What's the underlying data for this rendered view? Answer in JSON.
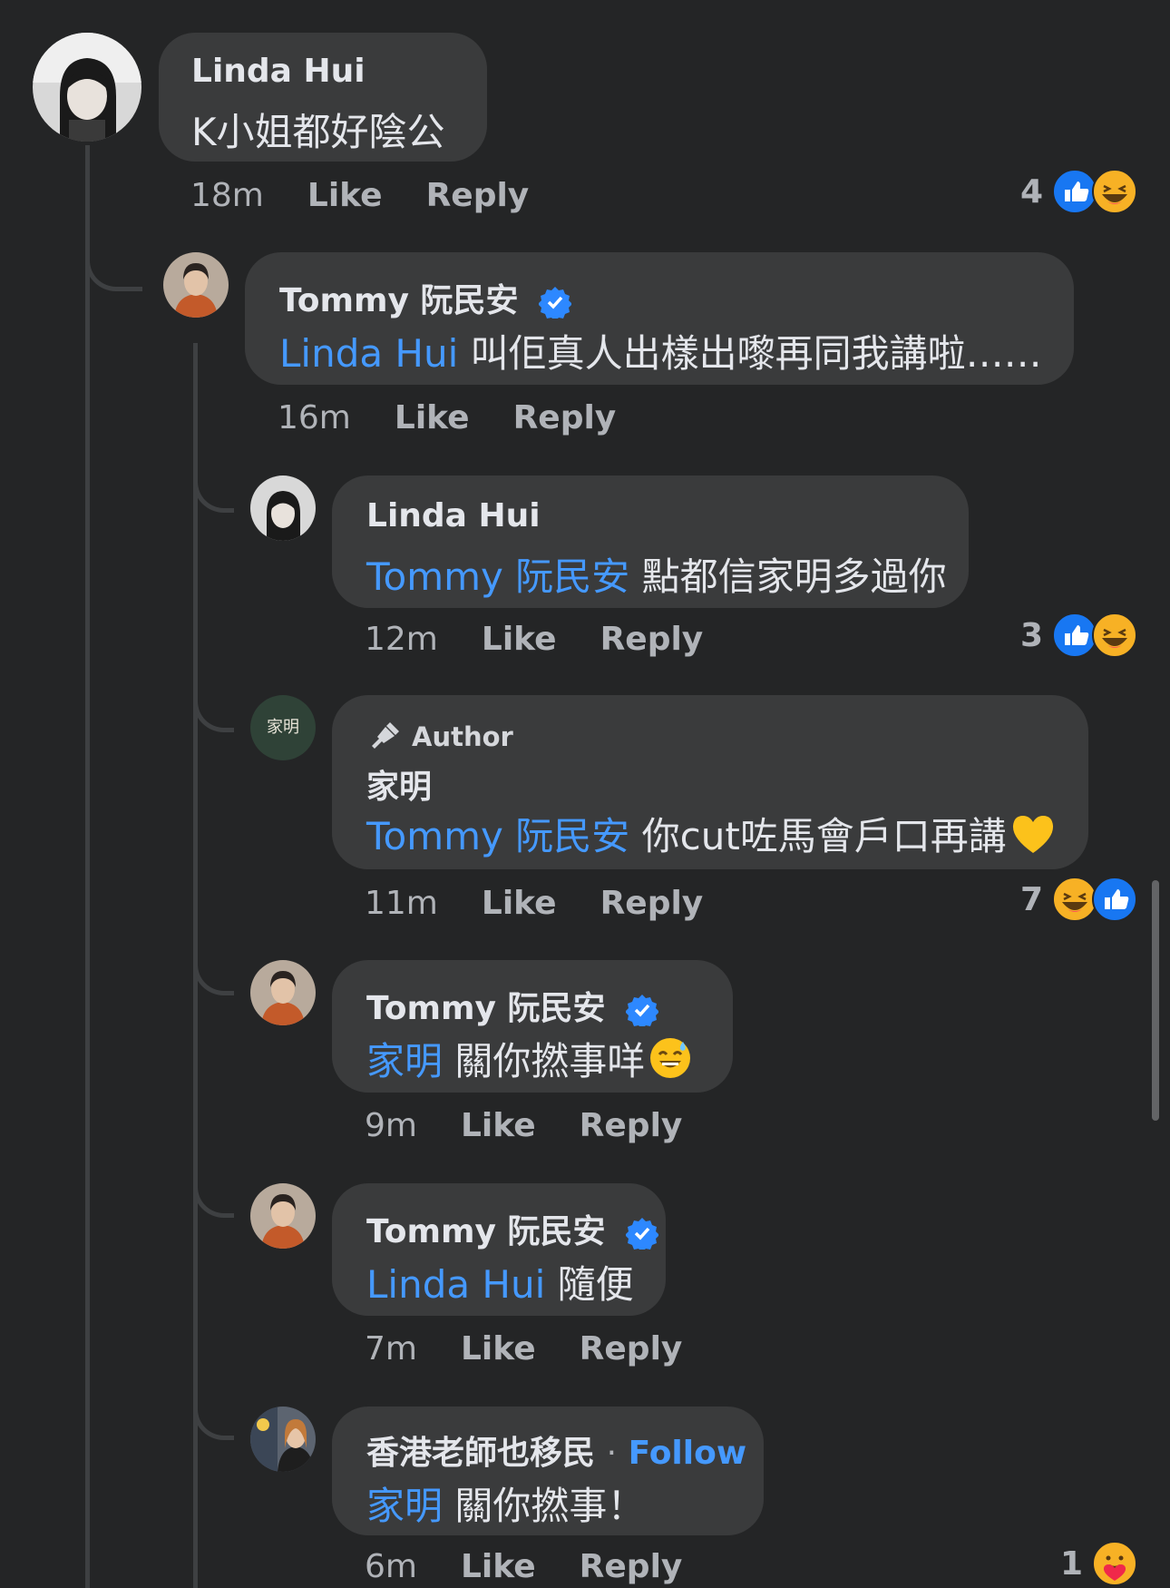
{
  "comments": [
    {
      "name": "Linda Hui",
      "text": "K小姐都好陰公",
      "time": "18m",
      "like": "Like",
      "reply": "Reply",
      "reaction_count": "4",
      "reactions": [
        "like-icon",
        "haha-icon"
      ]
    },
    {
      "name": "Tommy 阮民安",
      "mention": "Linda Hui",
      "text": "叫佢真人出樣出嚟再同我講啦……",
      "time": "16m",
      "like": "Like",
      "reply": "Reply"
    },
    {
      "name": "Linda Hui",
      "mention": "Tommy 阮民安",
      "text": "點都信家明多過你",
      "time": "12m",
      "like": "Like",
      "reply": "Reply",
      "reaction_count": "3",
      "reactions": [
        "like-icon",
        "haha-icon"
      ]
    },
    {
      "author_label": "Author",
      "name": "家明",
      "mention": "Tommy 阮民安",
      "text": "你cut咗馬會戶口再講",
      "time": "11m",
      "like": "Like",
      "reply": "Reply",
      "reaction_count": "7",
      "reactions": [
        "haha-icon",
        "like-icon"
      ]
    },
    {
      "name": "Tommy 阮民安",
      "mention": "家明",
      "text": "關你撚事咩",
      "time": "9m",
      "like": "Like",
      "reply": "Reply"
    },
    {
      "name": "Tommy 阮民安",
      "mention": "Linda Hui",
      "text": "隨便",
      "time": "7m",
      "like": "Like",
      "reply": "Reply"
    },
    {
      "name": "香港老師也移民",
      "separator": "·",
      "follow": "Follow",
      "mention": "家明",
      "text": "關你撚事！",
      "time": "6m",
      "like": "Like",
      "reply": "Reply",
      "reaction_count": "1",
      "reactions": [
        "care-icon"
      ]
    }
  ],
  "avatar_text": {
    "jiaming": "家明"
  },
  "colors": {
    "background": "#242526",
    "bubble": "#3a3b3c",
    "mention": "#4599ff",
    "like_blue": "#1877f2",
    "verified": "#2d88ff",
    "haha": "#f7b125"
  }
}
